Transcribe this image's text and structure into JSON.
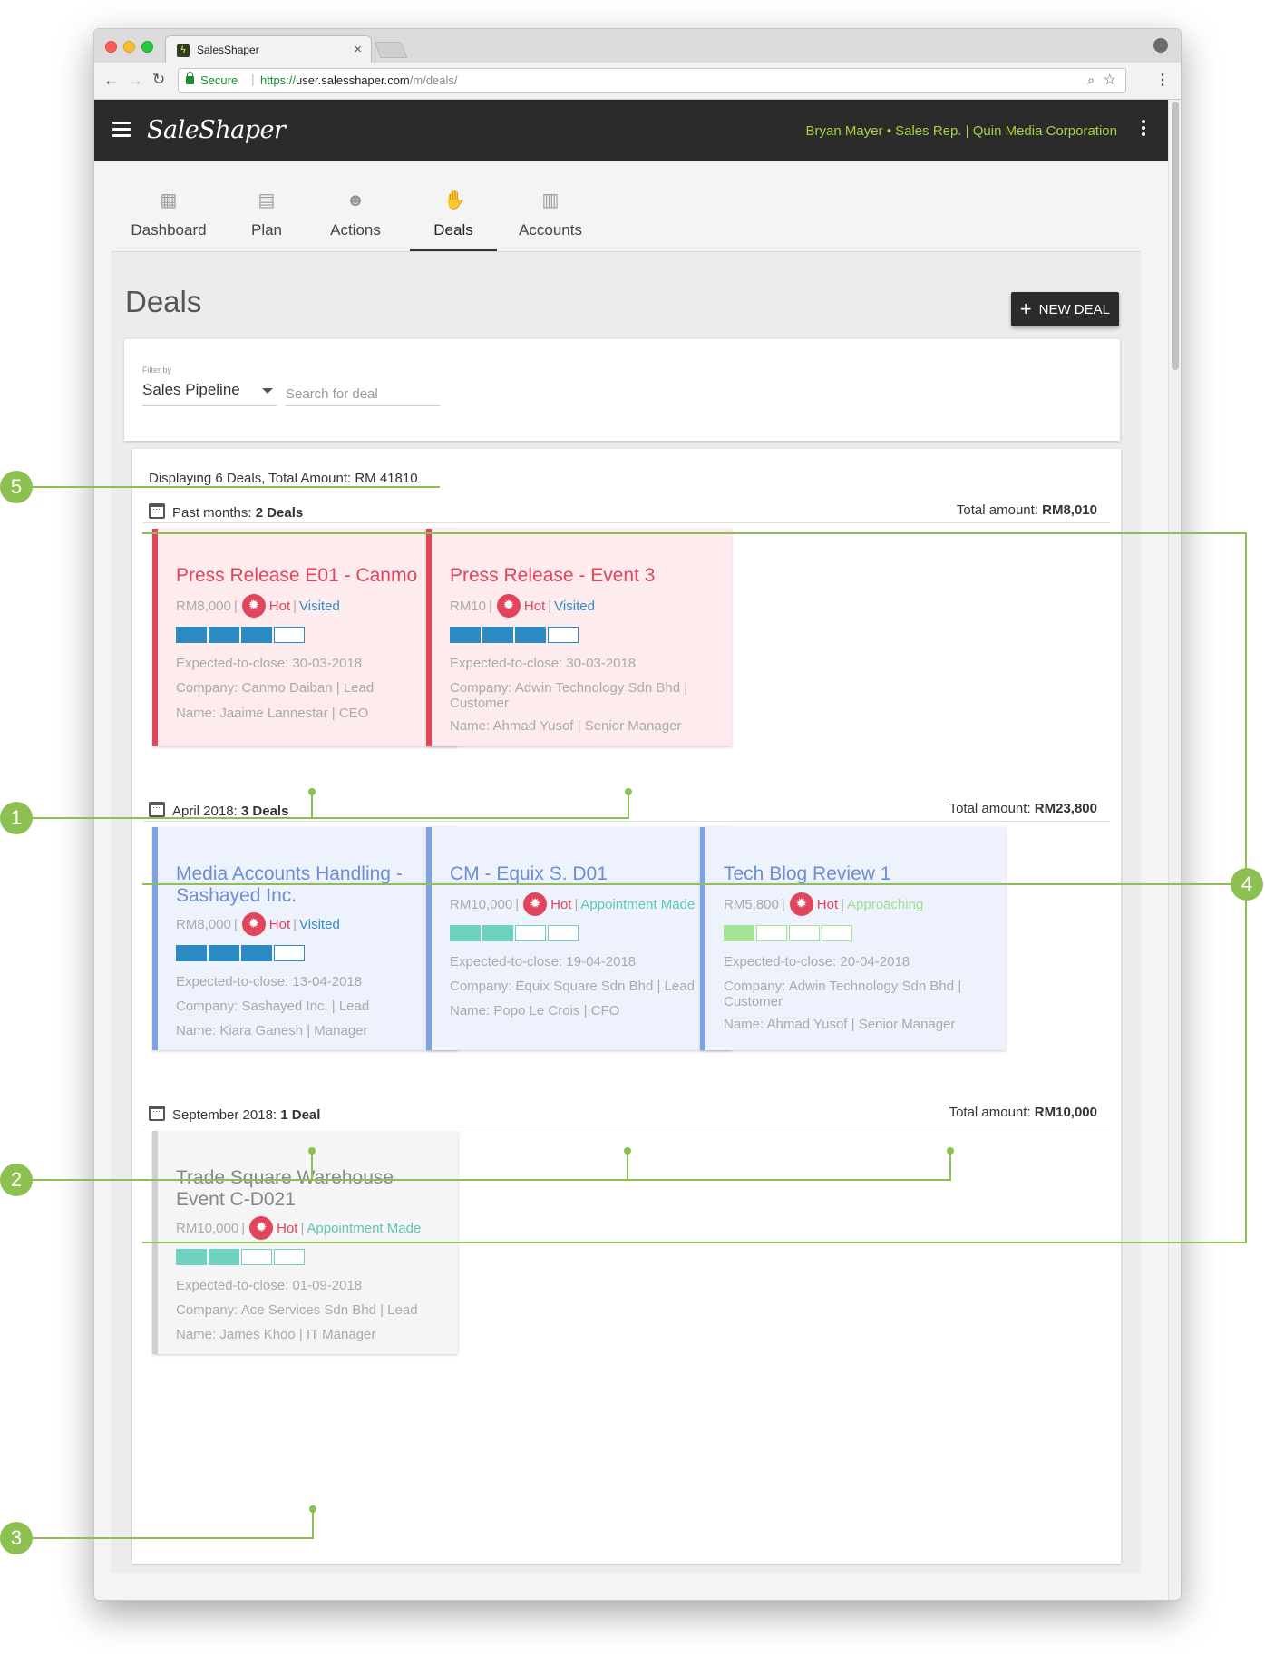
{
  "browser": {
    "tab_title": "SalesShaper",
    "secure_label": "Secure",
    "url_scheme": "https://",
    "url_host": "user.salesshaper.com",
    "url_path": "/m/deals/"
  },
  "app": {
    "logo": "SaleShaper",
    "user_info": "Bryan Mayer • Sales Rep. | Quin Media Corporation",
    "nav": [
      {
        "label": "Dashboard",
        "icon": "dashboard-icon"
      },
      {
        "label": "Plan",
        "icon": "plan-icon"
      },
      {
        "label": "Actions",
        "icon": "actions-icon"
      },
      {
        "label": "Deals",
        "icon": "deals-icon",
        "active": true
      },
      {
        "label": "Accounts",
        "icon": "accounts-icon"
      }
    ],
    "page_title": "Deals",
    "new_deal_label": "NEW DEAL",
    "filter": {
      "label": "Filter by",
      "selected": "Sales Pipeline",
      "search_placeholder": "Search for deal"
    },
    "summary": "Displaying 6 Deals, Total Amount: RM 41810"
  },
  "groups": [
    {
      "label": "Past months: ",
      "count": "2 Deals",
      "total_label": "Total amount: ",
      "total": "RM8,010",
      "deals": [
        {
          "title": "Press Release E01 - Canmo",
          "amount": "RM8,000",
          "temp": "Hot",
          "stage": "Visited",
          "progress": 3,
          "close": "Expected-to-close: 30-03-2018",
          "company": "Company: Canmo Daiban | Lead",
          "name": "Name: Jaaime Lannestar | CEO"
        },
        {
          "title": "Press Release - Event 3",
          "amount": "RM10",
          "temp": "Hot",
          "stage": "Visited",
          "progress": 3,
          "close": "Expected-to-close: 30-03-2018",
          "company": "Company: Adwin Technology Sdn Bhd | Customer",
          "name": "Name: Ahmad Yusof | Senior Manager"
        }
      ]
    },
    {
      "label": "April 2018: ",
      "count": "3 Deals",
      "total_label": "Total amount: ",
      "total": "RM23,800",
      "deals": [
        {
          "title": "Media Accounts Handling - Sashayed Inc.",
          "amount": "RM8,000",
          "temp": "Hot",
          "stage": "Visited",
          "progress": 3,
          "close": "Expected-to-close: 13-04-2018",
          "company": "Company: Sashayed Inc. | Lead",
          "name": "Name: Kiara Ganesh | Manager"
        },
        {
          "title": "CM - Equix S. D01",
          "amount": "RM10,000",
          "temp": "Hot",
          "stage": "Appointment Made",
          "progress": 2,
          "close": "Expected-to-close: 19-04-2018",
          "company": "Company: Equix Square Sdn Bhd | Lead",
          "name": "Name: Popo Le Crois | CFO"
        },
        {
          "title": "Tech Blog Review 1",
          "amount": "RM5,800",
          "temp": "Hot",
          "stage": "Approaching",
          "progress": 1,
          "close": "Expected-to-close: 20-04-2018",
          "company": "Company: Adwin Technology Sdn Bhd | Customer",
          "name": "Name: Ahmad Yusof | Senior Manager"
        }
      ]
    },
    {
      "label": "September 2018: ",
      "count": "1 Deal",
      "total_label": "Total amount: ",
      "total": "RM10,000",
      "deals": [
        {
          "title": "Trade Square Warehouse Event C-D021",
          "amount": "RM10,000",
          "temp": "Hot",
          "stage": "Appointment Made",
          "progress": 2,
          "close": "Expected-to-close: 01-09-2018",
          "company": "Company: Ace Services Sdn Bhd | Lead",
          "name": "Name: James Khoo | IT Manager"
        }
      ]
    }
  ],
  "annotations": [
    "1",
    "2",
    "3",
    "4",
    "5"
  ],
  "colors": {
    "hot_red": "#e0455b",
    "blue_bar": "#2a8bc3",
    "teal_bar": "#6fd1c0",
    "lime_bar": "#a5e398",
    "annotation_green": "#8cc152",
    "header_text": "#a4d13c"
  }
}
